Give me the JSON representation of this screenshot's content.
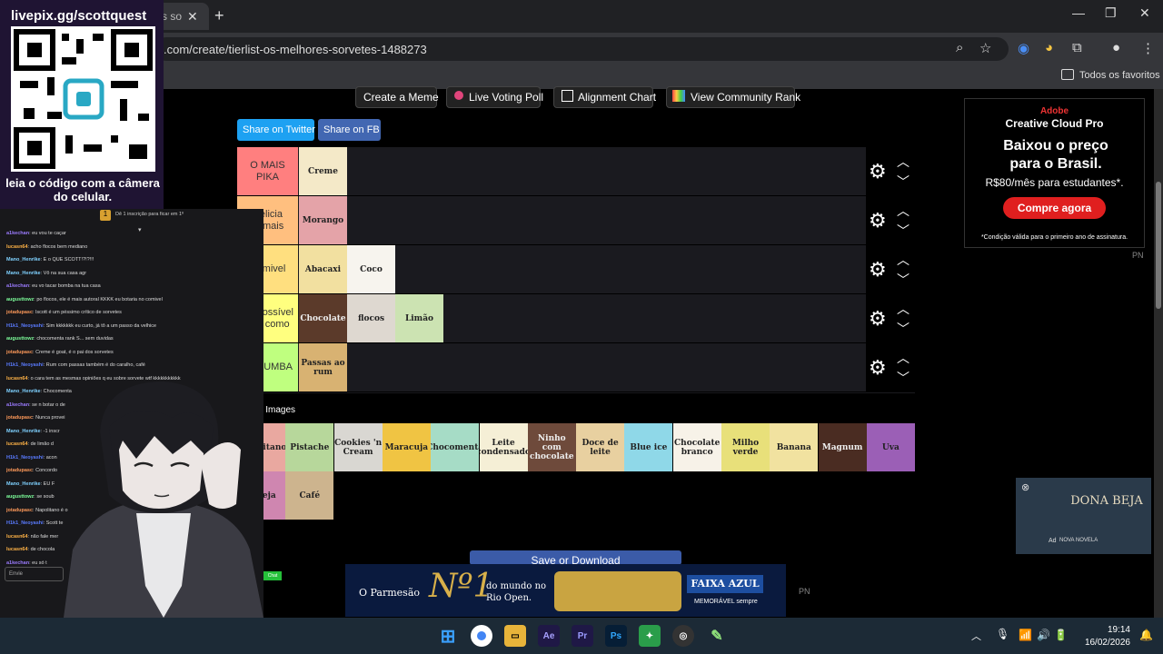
{
  "browser": {
    "tab_title": "s so",
    "url": ".com/create/tierlist-os-melhores-sorvetes-1488273",
    "bookmarks_label": "Todos os favoritos"
  },
  "toolbar_links": {
    "create_meme": "Create a Meme",
    "live_voting": "Live Voting Poll",
    "alignment_chart": "Alignment Chart",
    "community_rank": "View Community Rank"
  },
  "share": {
    "twitter": "Share on Twitter",
    "fb": "Share on FB"
  },
  "tiers": [
    {
      "label": "O MAIS PIKA",
      "color": "#ff7f7f",
      "items": [
        "Creme"
      ]
    },
    {
      "label": "Delicia demais",
      "color": "#ffbf7f",
      "items": [
        "Morango"
      ]
    },
    {
      "label": "Comivel",
      "color": "#ffdf7f",
      "items": [
        "Abacaxi",
        "Coco"
      ]
    },
    {
      "label": "Se possível não como",
      "color": "#ffff7f",
      "items": [
        "Chocolate",
        "flocos",
        "Limão"
      ]
    },
    {
      "label": "SUCUMBA",
      "color": "#bfff7f",
      "items": [
        "Passas ao rum"
      ]
    }
  ],
  "pin": {
    "title": "Pin Images",
    "items": [
      "Napolitano",
      "Pistache",
      "Cookies 'n Cream",
      "Maracuja",
      "Chocomenta",
      "Leite condensado",
      "Ninho com chocolate",
      "Doce de leite",
      "Blue ice",
      "Chocolate branco",
      "Milho verde",
      "Banana",
      "Magnum",
      "Uva",
      "Cereja",
      "Café"
    ]
  },
  "save_label": "Save or Download",
  "ads": {
    "right_brand": "Adobe",
    "right_product": "Creative Cloud Pro",
    "right_headline": "Baixou o preço para o Brasil.",
    "right_price": "R$80/mês para estudantes*.",
    "right_cta": "Compre agora",
    "right_footnote": "*Condição válida para o primeiro ano de assinatura.",
    "pn": "PN",
    "tv_title": "DONA BEJA",
    "tv_sub": "NOVA NOVELA",
    "tv_ad": "Ad",
    "bottom_text1": "O Parmesão",
    "bottom_text2": "Nº1",
    "bottom_text3": "do mundo no Rio Open.",
    "bottom_brand": "FAIXA AZUL",
    "bottom_slogan": "MEMORÁVEL sempre"
  },
  "overlay": {
    "qr_url": "livepix.gg/scottquest",
    "qr_caption": "leia o código com a câmera do celular.",
    "chat_hint": "Dê 1 inscrição para ficar em 1º",
    "chat_input": "Envie",
    "chat_button": "Chat"
  },
  "chat": [
    {
      "user": "a1kechan",
      "text": "eu vou te caçar"
    },
    {
      "user": "lucasn64",
      "text": "acho flocos bem mediano"
    },
    {
      "user": "Mano_Henrike",
      "text": "É o QUE SCOTT!?!?!!!"
    },
    {
      "user": "Mano_Henrike",
      "text": "Vô na sua casa agr"
    },
    {
      "user": "a1kechan",
      "text": "eu vo tacar bomba na tua casa"
    },
    {
      "user": "augusttowz",
      "text": "po flocos, ele é mais autoral KKKK eu botaria no comivel"
    },
    {
      "user": "jotadupasc",
      "text": "lscott é um péssimo crítico de sorvetes"
    },
    {
      "user": "H1k1_Neoyashi",
      "text": "Sim kkkkkkk eu curto, já tô a um passo da velhice"
    },
    {
      "user": "augusttowz",
      "text": "chocomenta rank S... sem duvidas"
    },
    {
      "user": "jotadupasc",
      "text": "Creme é goat, é o pai dos sorvetes"
    },
    {
      "user": "H1k1_Neoyashi",
      "text": "Rum com passas também é do caralho, café"
    },
    {
      "user": "lucasn64",
      "text": "o cara tem as mesmas opiniões q eu sobre sorvete wtf kkkkkkkkkkk"
    },
    {
      "user": "Mano_Henrike",
      "text": "Chocomenta"
    },
    {
      "user": "a1kechan",
      "text": "se n botar o de"
    },
    {
      "user": "jotadupasc",
      "text": "Nunca provei"
    },
    {
      "user": "Mano_Henrike",
      "text": "-1 inscr"
    },
    {
      "user": "lucasn64",
      "text": "de limão d"
    },
    {
      "user": "H1k1_Neoyashi",
      "text": "acon"
    },
    {
      "user": "jotadupasc",
      "text": "Concordo"
    },
    {
      "user": "Mano_Henrike",
      "text": "EU F"
    },
    {
      "user": "augusttowz",
      "text": "se soub"
    },
    {
      "user": "jotadupasc",
      "text": "Napolitano é o"
    },
    {
      "user": "H1k1_Neoyashi",
      "text": "Scott te"
    },
    {
      "user": "lucasn64",
      "text": "não fale mer"
    },
    {
      "user": "lucasn64",
      "text": "de chocola"
    },
    {
      "user": "a1kechan",
      "text": "eu só t"
    }
  ],
  "taskbar": {
    "time": "19:14",
    "date": "16/02/2026"
  },
  "colors": {
    "twitter": "#1da1f2",
    "fb": "#4267b2"
  }
}
